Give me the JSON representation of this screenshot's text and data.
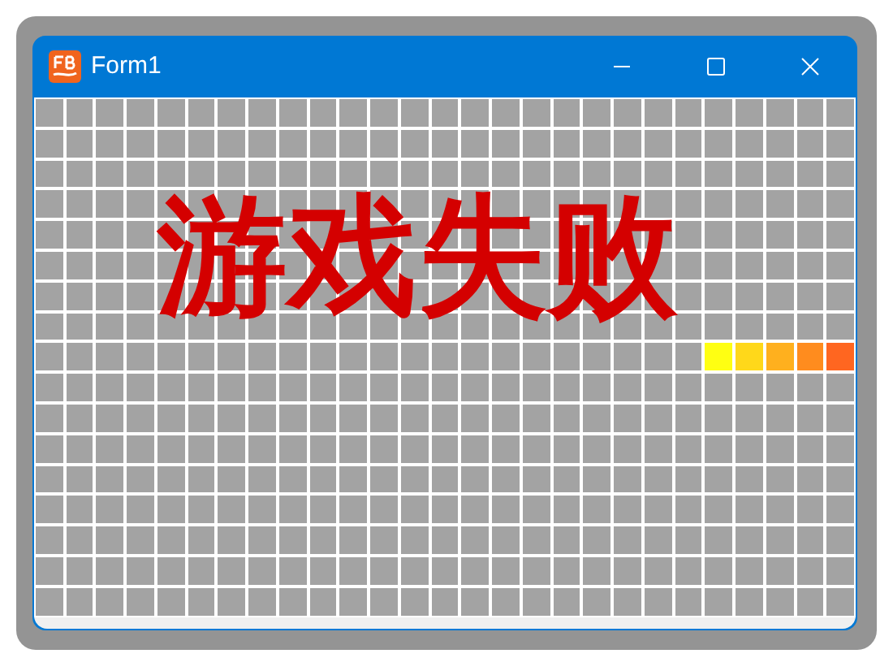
{
  "window": {
    "title": "Form1"
  },
  "message": "游戏失败",
  "board": {
    "rows": [
      {
        "cells": [
          {
            "color": "#a3a3a3"
          },
          {
            "color": "#a3a3a3"
          },
          {
            "color": "#a3a3a3"
          },
          {
            "color": "#a3a3a3"
          },
          {
            "color": "#a3a3a3"
          },
          {
            "color": "#a3a3a3"
          },
          {
            "color": "#a3a3a3"
          },
          {
            "color": "#a3a3a3"
          },
          {
            "color": "#a3a3a3"
          },
          {
            "color": "#a3a3a3"
          },
          {
            "color": "#a3a3a3"
          },
          {
            "color": "#a3a3a3"
          },
          {
            "color": "#a3a3a3"
          },
          {
            "color": "#a3a3a3"
          },
          {
            "color": "#a3a3a3"
          },
          {
            "color": "#a3a3a3"
          },
          {
            "color": "#a3a3a3"
          },
          {
            "color": "#a3a3a3"
          },
          {
            "color": "#a3a3a3"
          },
          {
            "color": "#a3a3a3"
          },
          {
            "color": "#a3a3a3"
          },
          {
            "color": "#a3a3a3"
          },
          {
            "color": "#a3a3a3"
          },
          {
            "color": "#a3a3a3"
          },
          {
            "color": "#a3a3a3"
          },
          {
            "color": "#a3a3a3"
          },
          {
            "color": "#a3a3a3"
          }
        ]
      },
      {
        "cells": [
          {
            "color": "#a3a3a3"
          },
          {
            "color": "#a3a3a3"
          },
          {
            "color": "#a3a3a3"
          },
          {
            "color": "#a3a3a3"
          },
          {
            "color": "#a3a3a3"
          },
          {
            "color": "#a3a3a3"
          },
          {
            "color": "#a3a3a3"
          },
          {
            "color": "#a3a3a3"
          },
          {
            "color": "#a3a3a3"
          },
          {
            "color": "#a3a3a3"
          },
          {
            "color": "#a3a3a3"
          },
          {
            "color": "#a3a3a3"
          },
          {
            "color": "#a3a3a3"
          },
          {
            "color": "#a3a3a3"
          },
          {
            "color": "#a3a3a3"
          },
          {
            "color": "#a3a3a3"
          },
          {
            "color": "#a3a3a3"
          },
          {
            "color": "#a3a3a3"
          },
          {
            "color": "#a3a3a3"
          },
          {
            "color": "#a3a3a3"
          },
          {
            "color": "#a3a3a3"
          },
          {
            "color": "#a3a3a3"
          },
          {
            "color": "#a3a3a3"
          },
          {
            "color": "#a3a3a3"
          },
          {
            "color": "#a3a3a3"
          },
          {
            "color": "#a3a3a3"
          },
          {
            "color": "#a3a3a3"
          }
        ]
      },
      {
        "cells": [
          {
            "color": "#a3a3a3"
          },
          {
            "color": "#a3a3a3"
          },
          {
            "color": "#a3a3a3"
          },
          {
            "color": "#a3a3a3"
          },
          {
            "color": "#a3a3a3"
          },
          {
            "color": "#a3a3a3"
          },
          {
            "color": "#a3a3a3"
          },
          {
            "color": "#a3a3a3"
          },
          {
            "color": "#a3a3a3"
          },
          {
            "color": "#a3a3a3"
          },
          {
            "color": "#a3a3a3"
          },
          {
            "color": "#a3a3a3"
          },
          {
            "color": "#a3a3a3"
          },
          {
            "color": "#a3a3a3"
          },
          {
            "color": "#a3a3a3"
          },
          {
            "color": "#a3a3a3"
          },
          {
            "color": "#a3a3a3"
          },
          {
            "color": "#a3a3a3"
          },
          {
            "color": "#a3a3a3"
          },
          {
            "color": "#a3a3a3"
          },
          {
            "color": "#a3a3a3"
          },
          {
            "color": "#a3a3a3"
          },
          {
            "color": "#a3a3a3"
          },
          {
            "color": "#a3a3a3"
          },
          {
            "color": "#a3a3a3"
          },
          {
            "color": "#a3a3a3"
          },
          {
            "color": "#a3a3a3"
          }
        ]
      },
      {
        "cells": [
          {
            "color": "#a3a3a3"
          },
          {
            "color": "#a3a3a3"
          },
          {
            "color": "#a3a3a3"
          },
          {
            "color": "#a3a3a3"
          },
          {
            "color": "#a3a3a3"
          },
          {
            "color": "#a3a3a3"
          },
          {
            "color": "#a3a3a3"
          },
          {
            "color": "#a3a3a3"
          },
          {
            "color": "#a3a3a3"
          },
          {
            "color": "#a3a3a3"
          },
          {
            "color": "#a3a3a3"
          },
          {
            "color": "#a3a3a3"
          },
          {
            "color": "#a3a3a3"
          },
          {
            "color": "#a3a3a3"
          },
          {
            "color": "#a3a3a3"
          },
          {
            "color": "#a3a3a3"
          },
          {
            "color": "#a3a3a3"
          },
          {
            "color": "#a3a3a3"
          },
          {
            "color": "#a3a3a3"
          },
          {
            "color": "#a3a3a3"
          },
          {
            "color": "#a3a3a3"
          },
          {
            "color": "#a3a3a3"
          },
          {
            "color": "#a3a3a3"
          },
          {
            "color": "#a3a3a3"
          },
          {
            "color": "#a3a3a3"
          },
          {
            "color": "#a3a3a3"
          },
          {
            "color": "#a3a3a3"
          }
        ]
      },
      {
        "cells": [
          {
            "color": "#a3a3a3"
          },
          {
            "color": "#a3a3a3"
          },
          {
            "color": "#a3a3a3"
          },
          {
            "color": "#a3a3a3"
          },
          {
            "color": "#a3a3a3"
          },
          {
            "color": "#a3a3a3"
          },
          {
            "color": "#a3a3a3"
          },
          {
            "color": "#a3a3a3"
          },
          {
            "color": "#a3a3a3"
          },
          {
            "color": "#a3a3a3"
          },
          {
            "color": "#a3a3a3"
          },
          {
            "color": "#a3a3a3"
          },
          {
            "color": "#a3a3a3"
          },
          {
            "color": "#a3a3a3"
          },
          {
            "color": "#a3a3a3"
          },
          {
            "color": "#a3a3a3"
          },
          {
            "color": "#a3a3a3"
          },
          {
            "color": "#a3a3a3"
          },
          {
            "color": "#a3a3a3"
          },
          {
            "color": "#a3a3a3"
          },
          {
            "color": "#a3a3a3"
          },
          {
            "color": "#a3a3a3"
          },
          {
            "color": "#a3a3a3"
          },
          {
            "color": "#a3a3a3"
          },
          {
            "color": "#a3a3a3"
          },
          {
            "color": "#a3a3a3"
          },
          {
            "color": "#a3a3a3"
          }
        ]
      },
      {
        "cells": [
          {
            "color": "#a3a3a3"
          },
          {
            "color": "#a3a3a3"
          },
          {
            "color": "#a3a3a3"
          },
          {
            "color": "#a3a3a3"
          },
          {
            "color": "#a3a3a3"
          },
          {
            "color": "#a3a3a3"
          },
          {
            "color": "#a3a3a3"
          },
          {
            "color": "#a3a3a3"
          },
          {
            "color": "#a3a3a3"
          },
          {
            "color": "#a3a3a3"
          },
          {
            "color": "#a3a3a3"
          },
          {
            "color": "#a3a3a3"
          },
          {
            "color": "#a3a3a3"
          },
          {
            "color": "#a3a3a3"
          },
          {
            "color": "#a3a3a3"
          },
          {
            "color": "#a3a3a3"
          },
          {
            "color": "#a3a3a3"
          },
          {
            "color": "#a3a3a3"
          },
          {
            "color": "#a3a3a3"
          },
          {
            "color": "#a3a3a3"
          },
          {
            "color": "#a3a3a3"
          },
          {
            "color": "#a3a3a3"
          },
          {
            "color": "#a3a3a3"
          },
          {
            "color": "#a3a3a3"
          },
          {
            "color": "#a3a3a3"
          },
          {
            "color": "#a3a3a3"
          },
          {
            "color": "#a3a3a3"
          }
        ]
      },
      {
        "cells": [
          {
            "color": "#a3a3a3"
          },
          {
            "color": "#a3a3a3"
          },
          {
            "color": "#a3a3a3"
          },
          {
            "color": "#a3a3a3"
          },
          {
            "color": "#a3a3a3"
          },
          {
            "color": "#a3a3a3"
          },
          {
            "color": "#a3a3a3"
          },
          {
            "color": "#a3a3a3"
          },
          {
            "color": "#a3a3a3"
          },
          {
            "color": "#a3a3a3"
          },
          {
            "color": "#a3a3a3"
          },
          {
            "color": "#a3a3a3"
          },
          {
            "color": "#a3a3a3"
          },
          {
            "color": "#a3a3a3"
          },
          {
            "color": "#a3a3a3"
          },
          {
            "color": "#a3a3a3"
          },
          {
            "color": "#a3a3a3"
          },
          {
            "color": "#a3a3a3"
          },
          {
            "color": "#a3a3a3"
          },
          {
            "color": "#a3a3a3"
          },
          {
            "color": "#a3a3a3"
          },
          {
            "color": "#a3a3a3"
          },
          {
            "color": "#a3a3a3"
          },
          {
            "color": "#a3a3a3"
          },
          {
            "color": "#a3a3a3"
          },
          {
            "color": "#a3a3a3"
          },
          {
            "color": "#a3a3a3"
          }
        ]
      },
      {
        "cells": [
          {
            "color": "#a3a3a3"
          },
          {
            "color": "#a3a3a3"
          },
          {
            "color": "#a3a3a3"
          },
          {
            "color": "#a3a3a3"
          },
          {
            "color": "#a3a3a3"
          },
          {
            "color": "#a3a3a3"
          },
          {
            "color": "#a3a3a3"
          },
          {
            "color": "#a3a3a3"
          },
          {
            "color": "#a3a3a3"
          },
          {
            "color": "#a3a3a3"
          },
          {
            "color": "#a3a3a3"
          },
          {
            "color": "#a3a3a3"
          },
          {
            "color": "#a3a3a3"
          },
          {
            "color": "#a3a3a3"
          },
          {
            "color": "#a3a3a3"
          },
          {
            "color": "#a3a3a3"
          },
          {
            "color": "#a3a3a3"
          },
          {
            "color": "#a3a3a3"
          },
          {
            "color": "#a3a3a3"
          },
          {
            "color": "#a3a3a3"
          },
          {
            "color": "#a3a3a3"
          },
          {
            "color": "#a3a3a3"
          },
          {
            "color": "#a3a3a3"
          },
          {
            "color": "#a3a3a3"
          },
          {
            "color": "#a3a3a3"
          },
          {
            "color": "#a3a3a3"
          },
          {
            "color": "#a3a3a3"
          }
        ]
      },
      {
        "cells": [
          {
            "color": "#a3a3a3"
          },
          {
            "color": "#a3a3a3"
          },
          {
            "color": "#a3a3a3"
          },
          {
            "color": "#a3a3a3"
          },
          {
            "color": "#a3a3a3"
          },
          {
            "color": "#a3a3a3"
          },
          {
            "color": "#a3a3a3"
          },
          {
            "color": "#a3a3a3"
          },
          {
            "color": "#a3a3a3"
          },
          {
            "color": "#a3a3a3"
          },
          {
            "color": "#a3a3a3"
          },
          {
            "color": "#a3a3a3"
          },
          {
            "color": "#a3a3a3"
          },
          {
            "color": "#a3a3a3"
          },
          {
            "color": "#a3a3a3"
          },
          {
            "color": "#a3a3a3"
          },
          {
            "color": "#a3a3a3"
          },
          {
            "color": "#a3a3a3"
          },
          {
            "color": "#a3a3a3"
          },
          {
            "color": "#a3a3a3"
          },
          {
            "color": "#a3a3a3"
          },
          {
            "color": "#a3a3a3"
          },
          {
            "color": "#ffff12"
          },
          {
            "color": "#ffd81a"
          },
          {
            "color": "#ffb01e"
          },
          {
            "color": "#ff8c1e"
          },
          {
            "color": "#ff6620"
          }
        ]
      },
      {
        "cells": [
          {
            "color": "#a3a3a3"
          },
          {
            "color": "#a3a3a3"
          },
          {
            "color": "#a3a3a3"
          },
          {
            "color": "#a3a3a3"
          },
          {
            "color": "#a3a3a3"
          },
          {
            "color": "#a3a3a3"
          },
          {
            "color": "#a3a3a3"
          },
          {
            "color": "#a3a3a3"
          },
          {
            "color": "#a3a3a3"
          },
          {
            "color": "#a3a3a3"
          },
          {
            "color": "#a3a3a3"
          },
          {
            "color": "#a3a3a3"
          },
          {
            "color": "#a3a3a3"
          },
          {
            "color": "#a3a3a3"
          },
          {
            "color": "#a3a3a3"
          },
          {
            "color": "#a3a3a3"
          },
          {
            "color": "#a3a3a3"
          },
          {
            "color": "#a3a3a3"
          },
          {
            "color": "#a3a3a3"
          },
          {
            "color": "#a3a3a3"
          },
          {
            "color": "#a3a3a3"
          },
          {
            "color": "#a3a3a3"
          },
          {
            "color": "#a3a3a3"
          },
          {
            "color": "#a3a3a3"
          },
          {
            "color": "#a3a3a3"
          },
          {
            "color": "#a3a3a3"
          },
          {
            "color": "#a3a3a3"
          }
        ]
      },
      {
        "cells": [
          {
            "color": "#a3a3a3"
          },
          {
            "color": "#a3a3a3"
          },
          {
            "color": "#a3a3a3"
          },
          {
            "color": "#a3a3a3"
          },
          {
            "color": "#a3a3a3"
          },
          {
            "color": "#a3a3a3"
          },
          {
            "color": "#a3a3a3"
          },
          {
            "color": "#a3a3a3"
          },
          {
            "color": "#a3a3a3"
          },
          {
            "color": "#a3a3a3"
          },
          {
            "color": "#a3a3a3"
          },
          {
            "color": "#a3a3a3"
          },
          {
            "color": "#a3a3a3"
          },
          {
            "color": "#a3a3a3"
          },
          {
            "color": "#a3a3a3"
          },
          {
            "color": "#a3a3a3"
          },
          {
            "color": "#a3a3a3"
          },
          {
            "color": "#a3a3a3"
          },
          {
            "color": "#a3a3a3"
          },
          {
            "color": "#a3a3a3"
          },
          {
            "color": "#a3a3a3"
          },
          {
            "color": "#a3a3a3"
          },
          {
            "color": "#a3a3a3"
          },
          {
            "color": "#a3a3a3"
          },
          {
            "color": "#a3a3a3"
          },
          {
            "color": "#a3a3a3"
          },
          {
            "color": "#a3a3a3"
          }
        ]
      },
      {
        "cells": [
          {
            "color": "#a3a3a3"
          },
          {
            "color": "#a3a3a3"
          },
          {
            "color": "#a3a3a3"
          },
          {
            "color": "#a3a3a3"
          },
          {
            "color": "#a3a3a3"
          },
          {
            "color": "#a3a3a3"
          },
          {
            "color": "#a3a3a3"
          },
          {
            "color": "#a3a3a3"
          },
          {
            "color": "#a3a3a3"
          },
          {
            "color": "#a3a3a3"
          },
          {
            "color": "#a3a3a3"
          },
          {
            "color": "#a3a3a3"
          },
          {
            "color": "#a3a3a3"
          },
          {
            "color": "#a3a3a3"
          },
          {
            "color": "#a3a3a3"
          },
          {
            "color": "#a3a3a3"
          },
          {
            "color": "#a3a3a3"
          },
          {
            "color": "#a3a3a3"
          },
          {
            "color": "#a3a3a3"
          },
          {
            "color": "#a3a3a3"
          },
          {
            "color": "#a3a3a3"
          },
          {
            "color": "#a3a3a3"
          },
          {
            "color": "#a3a3a3"
          },
          {
            "color": "#a3a3a3"
          },
          {
            "color": "#a3a3a3"
          },
          {
            "color": "#a3a3a3"
          },
          {
            "color": "#a3a3a3"
          }
        ]
      },
      {
        "cells": [
          {
            "color": "#a3a3a3"
          },
          {
            "color": "#a3a3a3"
          },
          {
            "color": "#a3a3a3"
          },
          {
            "color": "#a3a3a3"
          },
          {
            "color": "#a3a3a3"
          },
          {
            "color": "#a3a3a3"
          },
          {
            "color": "#a3a3a3"
          },
          {
            "color": "#a3a3a3"
          },
          {
            "color": "#a3a3a3"
          },
          {
            "color": "#a3a3a3"
          },
          {
            "color": "#a3a3a3"
          },
          {
            "color": "#a3a3a3"
          },
          {
            "color": "#a3a3a3"
          },
          {
            "color": "#a3a3a3"
          },
          {
            "color": "#a3a3a3"
          },
          {
            "color": "#a3a3a3"
          },
          {
            "color": "#a3a3a3"
          },
          {
            "color": "#a3a3a3"
          },
          {
            "color": "#a3a3a3"
          },
          {
            "color": "#a3a3a3"
          },
          {
            "color": "#a3a3a3"
          },
          {
            "color": "#a3a3a3"
          },
          {
            "color": "#a3a3a3"
          },
          {
            "color": "#a3a3a3"
          },
          {
            "color": "#a3a3a3"
          },
          {
            "color": "#a3a3a3"
          },
          {
            "color": "#a3a3a3"
          }
        ]
      },
      {
        "cells": [
          {
            "color": "#a3a3a3"
          },
          {
            "color": "#a3a3a3"
          },
          {
            "color": "#a3a3a3"
          },
          {
            "color": "#a3a3a3"
          },
          {
            "color": "#a3a3a3"
          },
          {
            "color": "#a3a3a3"
          },
          {
            "color": "#a3a3a3"
          },
          {
            "color": "#a3a3a3"
          },
          {
            "color": "#a3a3a3"
          },
          {
            "color": "#a3a3a3"
          },
          {
            "color": "#a3a3a3"
          },
          {
            "color": "#a3a3a3"
          },
          {
            "color": "#a3a3a3"
          },
          {
            "color": "#a3a3a3"
          },
          {
            "color": "#a3a3a3"
          },
          {
            "color": "#a3a3a3"
          },
          {
            "color": "#a3a3a3"
          },
          {
            "color": "#a3a3a3"
          },
          {
            "color": "#a3a3a3"
          },
          {
            "color": "#a3a3a3"
          },
          {
            "color": "#a3a3a3"
          },
          {
            "color": "#a3a3a3"
          },
          {
            "color": "#a3a3a3"
          },
          {
            "color": "#a3a3a3"
          },
          {
            "color": "#a3a3a3"
          },
          {
            "color": "#a3a3a3"
          },
          {
            "color": "#a3a3a3"
          }
        ]
      },
      {
        "cells": [
          {
            "color": "#a3a3a3"
          },
          {
            "color": "#a3a3a3"
          },
          {
            "color": "#a3a3a3"
          },
          {
            "color": "#a3a3a3"
          },
          {
            "color": "#a3a3a3"
          },
          {
            "color": "#a3a3a3"
          },
          {
            "color": "#a3a3a3"
          },
          {
            "color": "#a3a3a3"
          },
          {
            "color": "#a3a3a3"
          },
          {
            "color": "#a3a3a3"
          },
          {
            "color": "#a3a3a3"
          },
          {
            "color": "#a3a3a3"
          },
          {
            "color": "#a3a3a3"
          },
          {
            "color": "#a3a3a3"
          },
          {
            "color": "#a3a3a3"
          },
          {
            "color": "#a3a3a3"
          },
          {
            "color": "#a3a3a3"
          },
          {
            "color": "#a3a3a3"
          },
          {
            "color": "#a3a3a3"
          },
          {
            "color": "#a3a3a3"
          },
          {
            "color": "#a3a3a3"
          },
          {
            "color": "#a3a3a3"
          },
          {
            "color": "#a3a3a3"
          },
          {
            "color": "#a3a3a3"
          },
          {
            "color": "#a3a3a3"
          },
          {
            "color": "#a3a3a3"
          },
          {
            "color": "#a3a3a3"
          }
        ]
      },
      {
        "cells": [
          {
            "color": "#a3a3a3"
          },
          {
            "color": "#a3a3a3"
          },
          {
            "color": "#a3a3a3"
          },
          {
            "color": "#a3a3a3"
          },
          {
            "color": "#a3a3a3"
          },
          {
            "color": "#a3a3a3"
          },
          {
            "color": "#a3a3a3"
          },
          {
            "color": "#a3a3a3"
          },
          {
            "color": "#a3a3a3"
          },
          {
            "color": "#a3a3a3"
          },
          {
            "color": "#a3a3a3"
          },
          {
            "color": "#a3a3a3"
          },
          {
            "color": "#a3a3a3"
          },
          {
            "color": "#a3a3a3"
          },
          {
            "color": "#a3a3a3"
          },
          {
            "color": "#a3a3a3"
          },
          {
            "color": "#a3a3a3"
          },
          {
            "color": "#a3a3a3"
          },
          {
            "color": "#a3a3a3"
          },
          {
            "color": "#a3a3a3"
          },
          {
            "color": "#a3a3a3"
          },
          {
            "color": "#a3a3a3"
          },
          {
            "color": "#a3a3a3"
          },
          {
            "color": "#a3a3a3"
          },
          {
            "color": "#a3a3a3"
          },
          {
            "color": "#a3a3a3"
          },
          {
            "color": "#a3a3a3"
          }
        ]
      },
      {
        "cells": [
          {
            "color": "#a3a3a3"
          },
          {
            "color": "#a3a3a3"
          },
          {
            "color": "#a3a3a3"
          },
          {
            "color": "#a3a3a3"
          },
          {
            "color": "#a3a3a3"
          },
          {
            "color": "#a3a3a3"
          },
          {
            "color": "#a3a3a3"
          },
          {
            "color": "#a3a3a3"
          },
          {
            "color": "#a3a3a3"
          },
          {
            "color": "#a3a3a3"
          },
          {
            "color": "#a3a3a3"
          },
          {
            "color": "#a3a3a3"
          },
          {
            "color": "#a3a3a3"
          },
          {
            "color": "#a3a3a3"
          },
          {
            "color": "#a3a3a3"
          },
          {
            "color": "#a3a3a3"
          },
          {
            "color": "#a3a3a3"
          },
          {
            "color": "#a3a3a3"
          },
          {
            "color": "#a3a3a3"
          },
          {
            "color": "#a3a3a3"
          },
          {
            "color": "#a3a3a3"
          },
          {
            "color": "#a3a3a3"
          },
          {
            "color": "#a3a3a3"
          },
          {
            "color": "#a3a3a3"
          },
          {
            "color": "#a3a3a3"
          },
          {
            "color": "#a3a3a3"
          },
          {
            "color": "#a3a3a3"
          }
        ]
      }
    ]
  }
}
